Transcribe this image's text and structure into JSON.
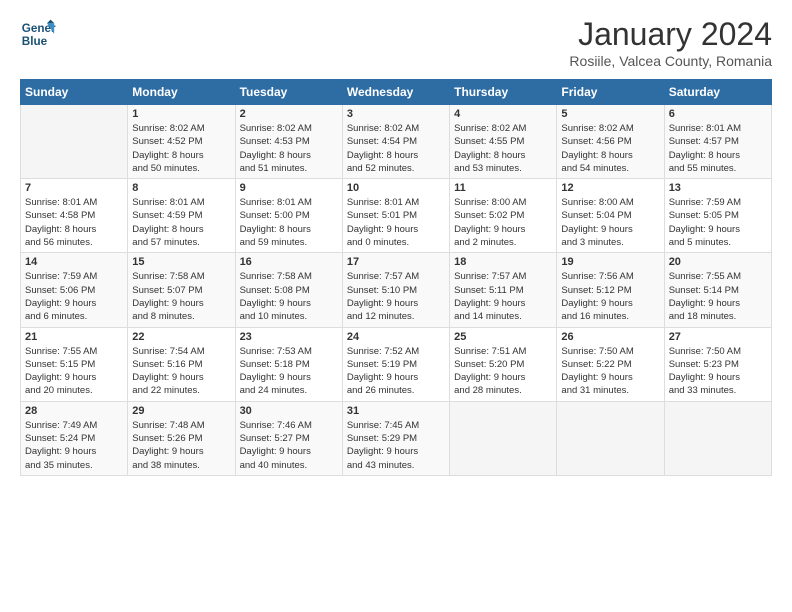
{
  "logo": {
    "line1": "General",
    "line2": "Blue"
  },
  "title": "January 2024",
  "subtitle": "Rosiile, Valcea County, Romania",
  "header_days": [
    "Sunday",
    "Monday",
    "Tuesday",
    "Wednesday",
    "Thursday",
    "Friday",
    "Saturday"
  ],
  "weeks": [
    [
      {
        "day": "",
        "info": ""
      },
      {
        "day": "1",
        "info": "Sunrise: 8:02 AM\nSunset: 4:52 PM\nDaylight: 8 hours\nand 50 minutes."
      },
      {
        "day": "2",
        "info": "Sunrise: 8:02 AM\nSunset: 4:53 PM\nDaylight: 8 hours\nand 51 minutes."
      },
      {
        "day": "3",
        "info": "Sunrise: 8:02 AM\nSunset: 4:54 PM\nDaylight: 8 hours\nand 52 minutes."
      },
      {
        "day": "4",
        "info": "Sunrise: 8:02 AM\nSunset: 4:55 PM\nDaylight: 8 hours\nand 53 minutes."
      },
      {
        "day": "5",
        "info": "Sunrise: 8:02 AM\nSunset: 4:56 PM\nDaylight: 8 hours\nand 54 minutes."
      },
      {
        "day": "6",
        "info": "Sunrise: 8:01 AM\nSunset: 4:57 PM\nDaylight: 8 hours\nand 55 minutes."
      }
    ],
    [
      {
        "day": "7",
        "info": "Sunrise: 8:01 AM\nSunset: 4:58 PM\nDaylight: 8 hours\nand 56 minutes."
      },
      {
        "day": "8",
        "info": "Sunrise: 8:01 AM\nSunset: 4:59 PM\nDaylight: 8 hours\nand 57 minutes."
      },
      {
        "day": "9",
        "info": "Sunrise: 8:01 AM\nSunset: 5:00 PM\nDaylight: 8 hours\nand 59 minutes."
      },
      {
        "day": "10",
        "info": "Sunrise: 8:01 AM\nSunset: 5:01 PM\nDaylight: 9 hours\nand 0 minutes."
      },
      {
        "day": "11",
        "info": "Sunrise: 8:00 AM\nSunset: 5:02 PM\nDaylight: 9 hours\nand 2 minutes."
      },
      {
        "day": "12",
        "info": "Sunrise: 8:00 AM\nSunset: 5:04 PM\nDaylight: 9 hours\nand 3 minutes."
      },
      {
        "day": "13",
        "info": "Sunrise: 7:59 AM\nSunset: 5:05 PM\nDaylight: 9 hours\nand 5 minutes."
      }
    ],
    [
      {
        "day": "14",
        "info": "Sunrise: 7:59 AM\nSunset: 5:06 PM\nDaylight: 9 hours\nand 6 minutes."
      },
      {
        "day": "15",
        "info": "Sunrise: 7:58 AM\nSunset: 5:07 PM\nDaylight: 9 hours\nand 8 minutes."
      },
      {
        "day": "16",
        "info": "Sunrise: 7:58 AM\nSunset: 5:08 PM\nDaylight: 9 hours\nand 10 minutes."
      },
      {
        "day": "17",
        "info": "Sunrise: 7:57 AM\nSunset: 5:10 PM\nDaylight: 9 hours\nand 12 minutes."
      },
      {
        "day": "18",
        "info": "Sunrise: 7:57 AM\nSunset: 5:11 PM\nDaylight: 9 hours\nand 14 minutes."
      },
      {
        "day": "19",
        "info": "Sunrise: 7:56 AM\nSunset: 5:12 PM\nDaylight: 9 hours\nand 16 minutes."
      },
      {
        "day": "20",
        "info": "Sunrise: 7:55 AM\nSunset: 5:14 PM\nDaylight: 9 hours\nand 18 minutes."
      }
    ],
    [
      {
        "day": "21",
        "info": "Sunrise: 7:55 AM\nSunset: 5:15 PM\nDaylight: 9 hours\nand 20 minutes."
      },
      {
        "day": "22",
        "info": "Sunrise: 7:54 AM\nSunset: 5:16 PM\nDaylight: 9 hours\nand 22 minutes."
      },
      {
        "day": "23",
        "info": "Sunrise: 7:53 AM\nSunset: 5:18 PM\nDaylight: 9 hours\nand 24 minutes."
      },
      {
        "day": "24",
        "info": "Sunrise: 7:52 AM\nSunset: 5:19 PM\nDaylight: 9 hours\nand 26 minutes."
      },
      {
        "day": "25",
        "info": "Sunrise: 7:51 AM\nSunset: 5:20 PM\nDaylight: 9 hours\nand 28 minutes."
      },
      {
        "day": "26",
        "info": "Sunrise: 7:50 AM\nSunset: 5:22 PM\nDaylight: 9 hours\nand 31 minutes."
      },
      {
        "day": "27",
        "info": "Sunrise: 7:50 AM\nSunset: 5:23 PM\nDaylight: 9 hours\nand 33 minutes."
      }
    ],
    [
      {
        "day": "28",
        "info": "Sunrise: 7:49 AM\nSunset: 5:24 PM\nDaylight: 9 hours\nand 35 minutes."
      },
      {
        "day": "29",
        "info": "Sunrise: 7:48 AM\nSunset: 5:26 PM\nDaylight: 9 hours\nand 38 minutes."
      },
      {
        "day": "30",
        "info": "Sunrise: 7:46 AM\nSunset: 5:27 PM\nDaylight: 9 hours\nand 40 minutes."
      },
      {
        "day": "31",
        "info": "Sunrise: 7:45 AM\nSunset: 5:29 PM\nDaylight: 9 hours\nand 43 minutes."
      },
      {
        "day": "",
        "info": ""
      },
      {
        "day": "",
        "info": ""
      },
      {
        "day": "",
        "info": ""
      }
    ]
  ]
}
